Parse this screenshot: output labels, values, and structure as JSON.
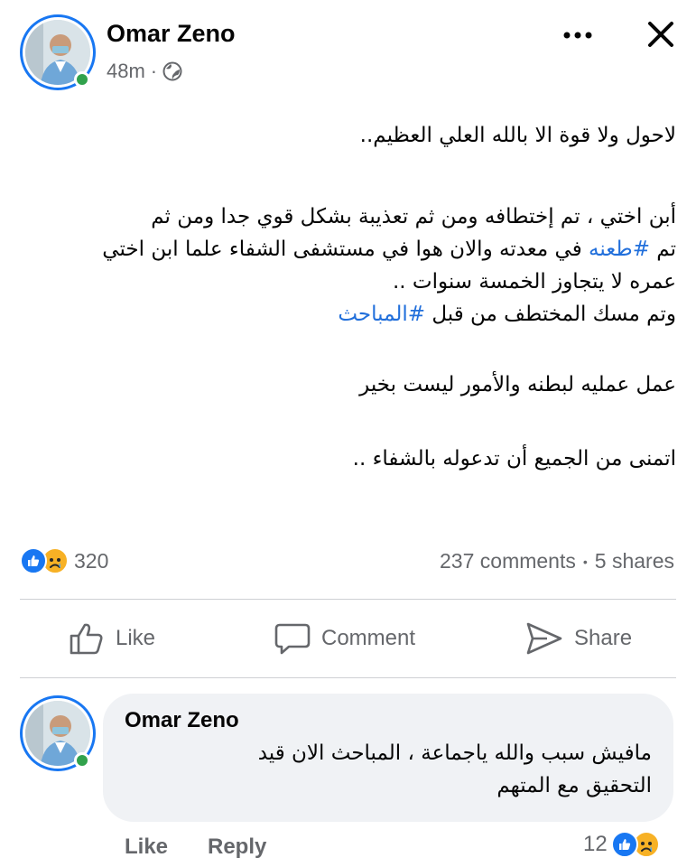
{
  "post": {
    "author": "Omar Zeno",
    "time": "48m",
    "separator": "·",
    "privacy_icon": "globe-icon",
    "more_icon": "more-options-icon",
    "close_icon": "close-icon",
    "lines": [
      "لاحول ولا قوة الا بالله العلي العظيم..",
      "أبن اختي ، تم إختطافه ومن ثم تعذيبة بشكل قوي جدا ومن ثم",
      "في معدته والان هوا في مستشفى الشفاء علما ابن اختي",
      "عمره لا يتجاوز الخمسة سنوات ..",
      "وتم مسك المختطف من قبل",
      "عمل عمليه لبطنه والأمور ليست بخير",
      "اتمنى من الجميع أن تدعوله بالشفاء .."
    ],
    "line3_prefix": "تم",
    "hashtag_1": "#طعنه",
    "hashtag_2": "#المباحث"
  },
  "stats": {
    "reactions_count": "320",
    "comments": "237 comments",
    "dot": "•",
    "shares": "5 shares"
  },
  "actions": {
    "like": "Like",
    "comment": "Comment",
    "share": "Share"
  },
  "comment": {
    "author": "Omar Zeno",
    "lines": [
      "مافيش سبب والله ياجماعة ، المباحث الان قيد",
      "التحقيق مع المتهم"
    ],
    "like": "Like",
    "reply": "Reply",
    "reaction_count": "12"
  },
  "colors": {
    "accent": "#1877f2",
    "hashtag": "#216fdb",
    "online": "#31a24c",
    "secondary_text": "#65676b"
  }
}
